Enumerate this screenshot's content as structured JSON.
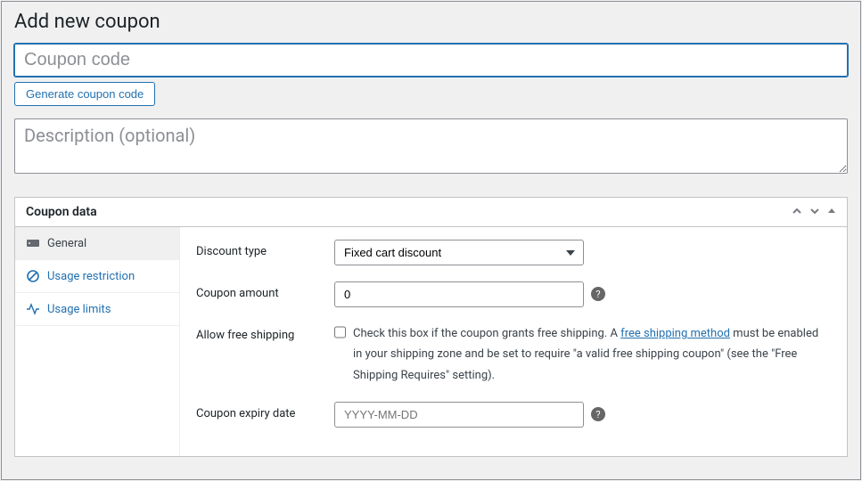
{
  "page": {
    "title": "Add new coupon"
  },
  "form": {
    "code_placeholder": "Coupon code",
    "generate_label": "Generate coupon code",
    "desc_placeholder": "Description (optional)"
  },
  "panel": {
    "title": "Coupon data",
    "sidebar": {
      "items": [
        {
          "label": "General"
        },
        {
          "label": "Usage restriction"
        },
        {
          "label": "Usage limits"
        }
      ]
    },
    "fields": {
      "discount_type": {
        "label": "Discount type",
        "value": "Fixed cart discount"
      },
      "coupon_amount": {
        "label": "Coupon amount",
        "value": "0"
      },
      "free_shipping": {
        "label": "Allow free shipping",
        "desc_prefix": "Check this box if the coupon grants free shipping. A ",
        "link_text": "free shipping method",
        "desc_suffix": " must be enabled in your shipping zone and be set to require \"a valid free shipping coupon\" (see the \"Free Shipping Requires\" setting)."
      },
      "expiry": {
        "label": "Coupon expiry date",
        "placeholder": "YYYY-MM-DD"
      }
    }
  }
}
